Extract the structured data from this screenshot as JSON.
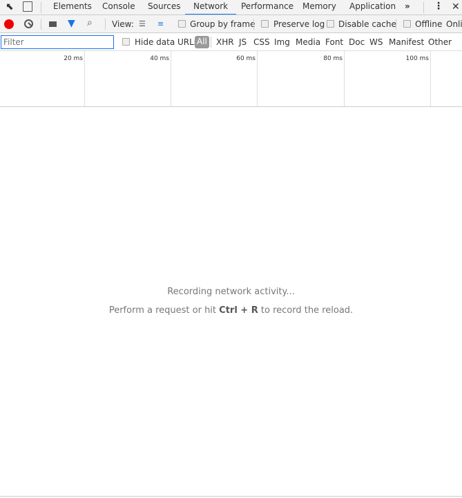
{
  "tabs": [
    "Elements",
    "Console",
    "Sources",
    "Network",
    "Performance",
    "Memory",
    "Application"
  ],
  "active_tab": "Network",
  "more": "»",
  "toolbar": {
    "view_label": "View:",
    "group_by_frame": "Group by frame",
    "preserve_log": "Preserve log",
    "disable_cache": "Disable cache",
    "offline": "Offline",
    "online": "Online"
  },
  "filter": {
    "placeholder": "Filter",
    "hide_data_urls": "Hide data URLs",
    "types": [
      "All",
      "XHR",
      "JS",
      "CSS",
      "Img",
      "Media",
      "Font",
      "Doc",
      "WS",
      "Manifest",
      "Other"
    ]
  },
  "timeline": {
    "ticks": [
      "20 ms",
      "40 ms",
      "60 ms",
      "80 ms",
      "100 ms"
    ]
  },
  "empty": {
    "line1": "Recording network activity...",
    "pre": "Perform a request or hit ",
    "key1": "Ctrl",
    "plus": " + ",
    "key2": "R",
    "post": " to record the reload."
  },
  "colors": {
    "record": "#e00",
    "accent": "#1a73e8"
  }
}
